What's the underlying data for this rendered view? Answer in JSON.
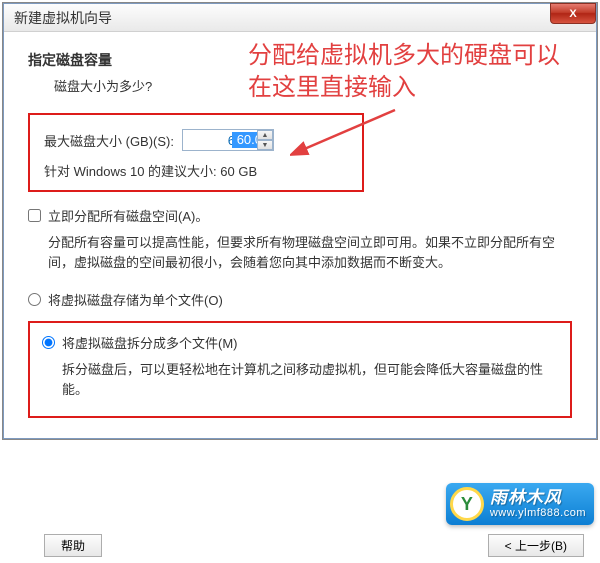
{
  "window": {
    "title": "新建虚拟机向导",
    "close_x": "X"
  },
  "wizard": {
    "heading": "指定磁盘容量",
    "subheading": "磁盘大小为多少?"
  },
  "annotation": {
    "text": "分配给虚拟机多大的硬盘可以在这里直接输入"
  },
  "disk": {
    "max_label": "最大磁盘大小 (GB)(S):",
    "max_value": "60.0",
    "recommendation": "针对 Windows 10 的建议大小: 60 GB"
  },
  "allocate": {
    "checkbox_label": "立即分配所有磁盘空间(A)。",
    "desc": "分配所有容量可以提高性能，但要求所有物理磁盘空间立即可用。如果不立即分配所有空间，虚拟磁盘的空间最初很小，会随着您向其中添加数据而不断变大。"
  },
  "store": {
    "single_label": "将虚拟磁盘存储为单个文件(O)",
    "multi_label": "将虚拟磁盘拆分成多个文件(M)",
    "multi_desc": "拆分磁盘后，可以更轻松地在计算机之间移动虚拟机，但可能会降低大容量磁盘的性能。"
  },
  "buttons": {
    "help": "帮助",
    "back": "< 上一步(B)"
  },
  "watermark": {
    "brand": "雨林木风",
    "url": "www.ylmf888.com",
    "logo_letter": "Y"
  }
}
